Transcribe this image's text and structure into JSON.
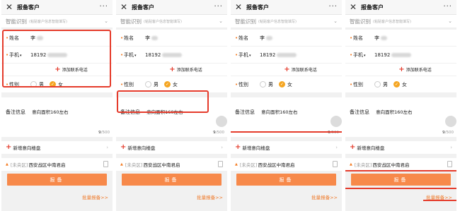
{
  "header": {
    "close_icon": "close-icon",
    "title": "报备客户",
    "more_icon": "more-icon"
  },
  "smart": {
    "label": "智能识别",
    "hint": "(粘贴客户信息智能填写)"
  },
  "form": {
    "name_label": "姓名",
    "name_value": "李",
    "phone_label": "手机",
    "phone_value": "18192",
    "add_phone": "添加联系电话",
    "gender_label": "性别",
    "male": "男",
    "female": "女",
    "selected_gender": "女"
  },
  "remark": {
    "label": "备注信息",
    "value": "意向面积160左右",
    "count": "9",
    "max": "/500"
  },
  "new_project": {
    "label": "新增意向楼盘"
  },
  "project": {
    "tag": "[未央区]",
    "name": "西安战区中南君启"
  },
  "submit": {
    "label": "报备"
  },
  "batch": {
    "label": "批量报备>>"
  },
  "colors": {
    "accent": "#f7894a",
    "annotation": "#e53b2b",
    "checked": "#f5a623"
  }
}
